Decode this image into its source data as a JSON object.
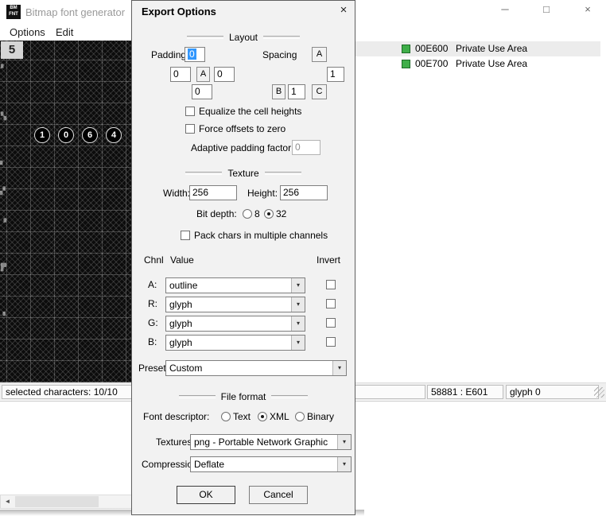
{
  "colors": {
    "block_green": "#3fae49",
    "selection_blue": "#3297fd"
  },
  "icons": {
    "dropdown_arrow": "▾",
    "close": "×",
    "minimize": "─",
    "maximize": "□",
    "scroll_left": "◄"
  },
  "main_window": {
    "title": "Bitmap font generator",
    "icon": {
      "line1": "BM",
      "line2": "FNT"
    },
    "menu": [
      "Options",
      "Edit"
    ],
    "glyph_preview": "5",
    "circled_glyphs": [
      "1",
      "0",
      "6",
      "4"
    ],
    "left_marks": [
      "▘",
      "▚",
      "▖",
      "▞",
      "▝",
      "▛",
      "▗"
    ],
    "blocks": [
      {
        "code": "00E600",
        "name": "Private Use Area"
      },
      {
        "code": "00E700",
        "name": "Private Use Area"
      }
    ],
    "status": {
      "selected": "selected characters: 10/10",
      "char_cell": "58881 : E601",
      "glyph_cell": "glyph 0"
    }
  },
  "dialog": {
    "title": "Export Options",
    "sections": {
      "layout": "Layout",
      "texture": "Texture",
      "file_format": "File format"
    },
    "layout": {
      "padding_label": "Padding",
      "spacing_label": "Spacing",
      "padding": {
        "top": "0",
        "left": "0",
        "right": "0",
        "bottom": "0"
      },
      "spacing": {
        "vertical": "1",
        "horizontal": "1"
      },
      "letters": {
        "a": "A",
        "b": "B",
        "c": "C"
      },
      "equalize_label": "Equalize the cell heights",
      "force_label": "Force offsets to zero",
      "adaptive_label": "Adaptive padding factor:",
      "adaptive_value": "0"
    },
    "texture": {
      "width_label": "Width:",
      "width_value": "256",
      "height_label": "Height:",
      "height_value": "256",
      "bit_depth_label": "Bit depth:",
      "bit_options": {
        "b8": "8",
        "b32": "32"
      },
      "pack_label": "Pack chars in multiple channels",
      "headers": {
        "chnl": "Chnl",
        "value": "Value",
        "invert": "Invert"
      },
      "channels": [
        {
          "label": "A:",
          "value": "outline"
        },
        {
          "label": "R:",
          "value": "glyph"
        },
        {
          "label": "G:",
          "value": "glyph"
        },
        {
          "label": "B:",
          "value": "glyph"
        }
      ],
      "presets_label": "Presets:",
      "presets_value": "Custom"
    },
    "file": {
      "descriptor_label": "Font descriptor:",
      "desc_options": {
        "text": "Text",
        "xml": "XML",
        "binary": "Binary"
      },
      "textures_label": "Textures:",
      "textures_value": "png - Portable Network Graphic",
      "compression_label": "Compression:",
      "compression_value": "Deflate"
    },
    "buttons": {
      "ok": "OK",
      "cancel": "Cancel"
    }
  }
}
